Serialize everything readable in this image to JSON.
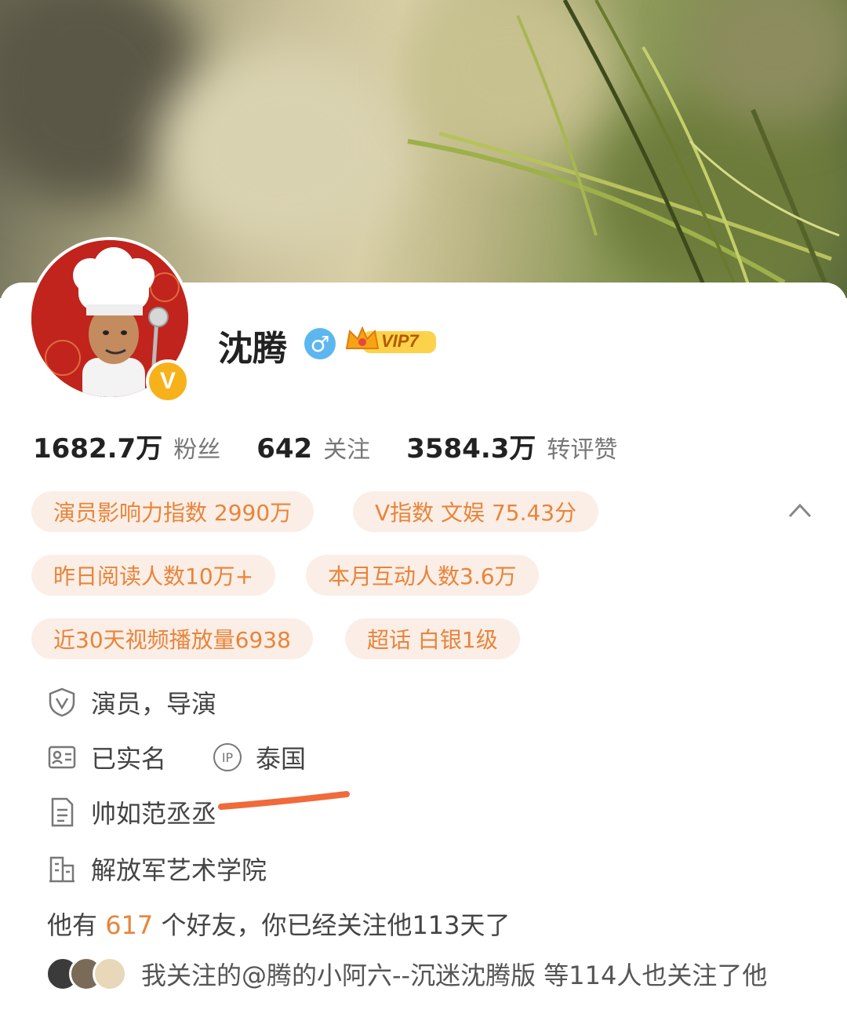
{
  "profile": {
    "name": "沈腾",
    "gender_symbol": "♂",
    "vip_label": "VIP7",
    "verified_badge": "V"
  },
  "stats": [
    {
      "value": "1682.7万",
      "label": "粉丝"
    },
    {
      "value": "642",
      "label": "关注"
    },
    {
      "value": "3584.3万",
      "label": "转评赞"
    }
  ],
  "chips": [
    "演员影响力指数 2990万",
    "V指数 文娱 75.43分",
    "昨日阅读人数10万+",
    "本月互动人数3.6万",
    "近30天视频播放量6938",
    "超话 白银1级"
  ],
  "info": {
    "verification": "演员，导演",
    "real_name": "已实名",
    "ip_label": "IP",
    "ip_location": "泰国",
    "bio": "帅如范丞丞",
    "school": "解放军艺术学院"
  },
  "friends": {
    "prefix": "他有 ",
    "count": "617",
    "suffix": " 个好友，你已经关注他113天了"
  },
  "mutual_follow": {
    "text": "我关注的@腾的小阿六--沉迷沈腾版 等114人也关注了他"
  },
  "colors": {
    "accent": "#e8843a",
    "chip_bg": "#fbeee6",
    "gender_blue": "#5cb7f0",
    "vip_gold": "#f5b51b",
    "annotation_red": "#f06a3a"
  }
}
